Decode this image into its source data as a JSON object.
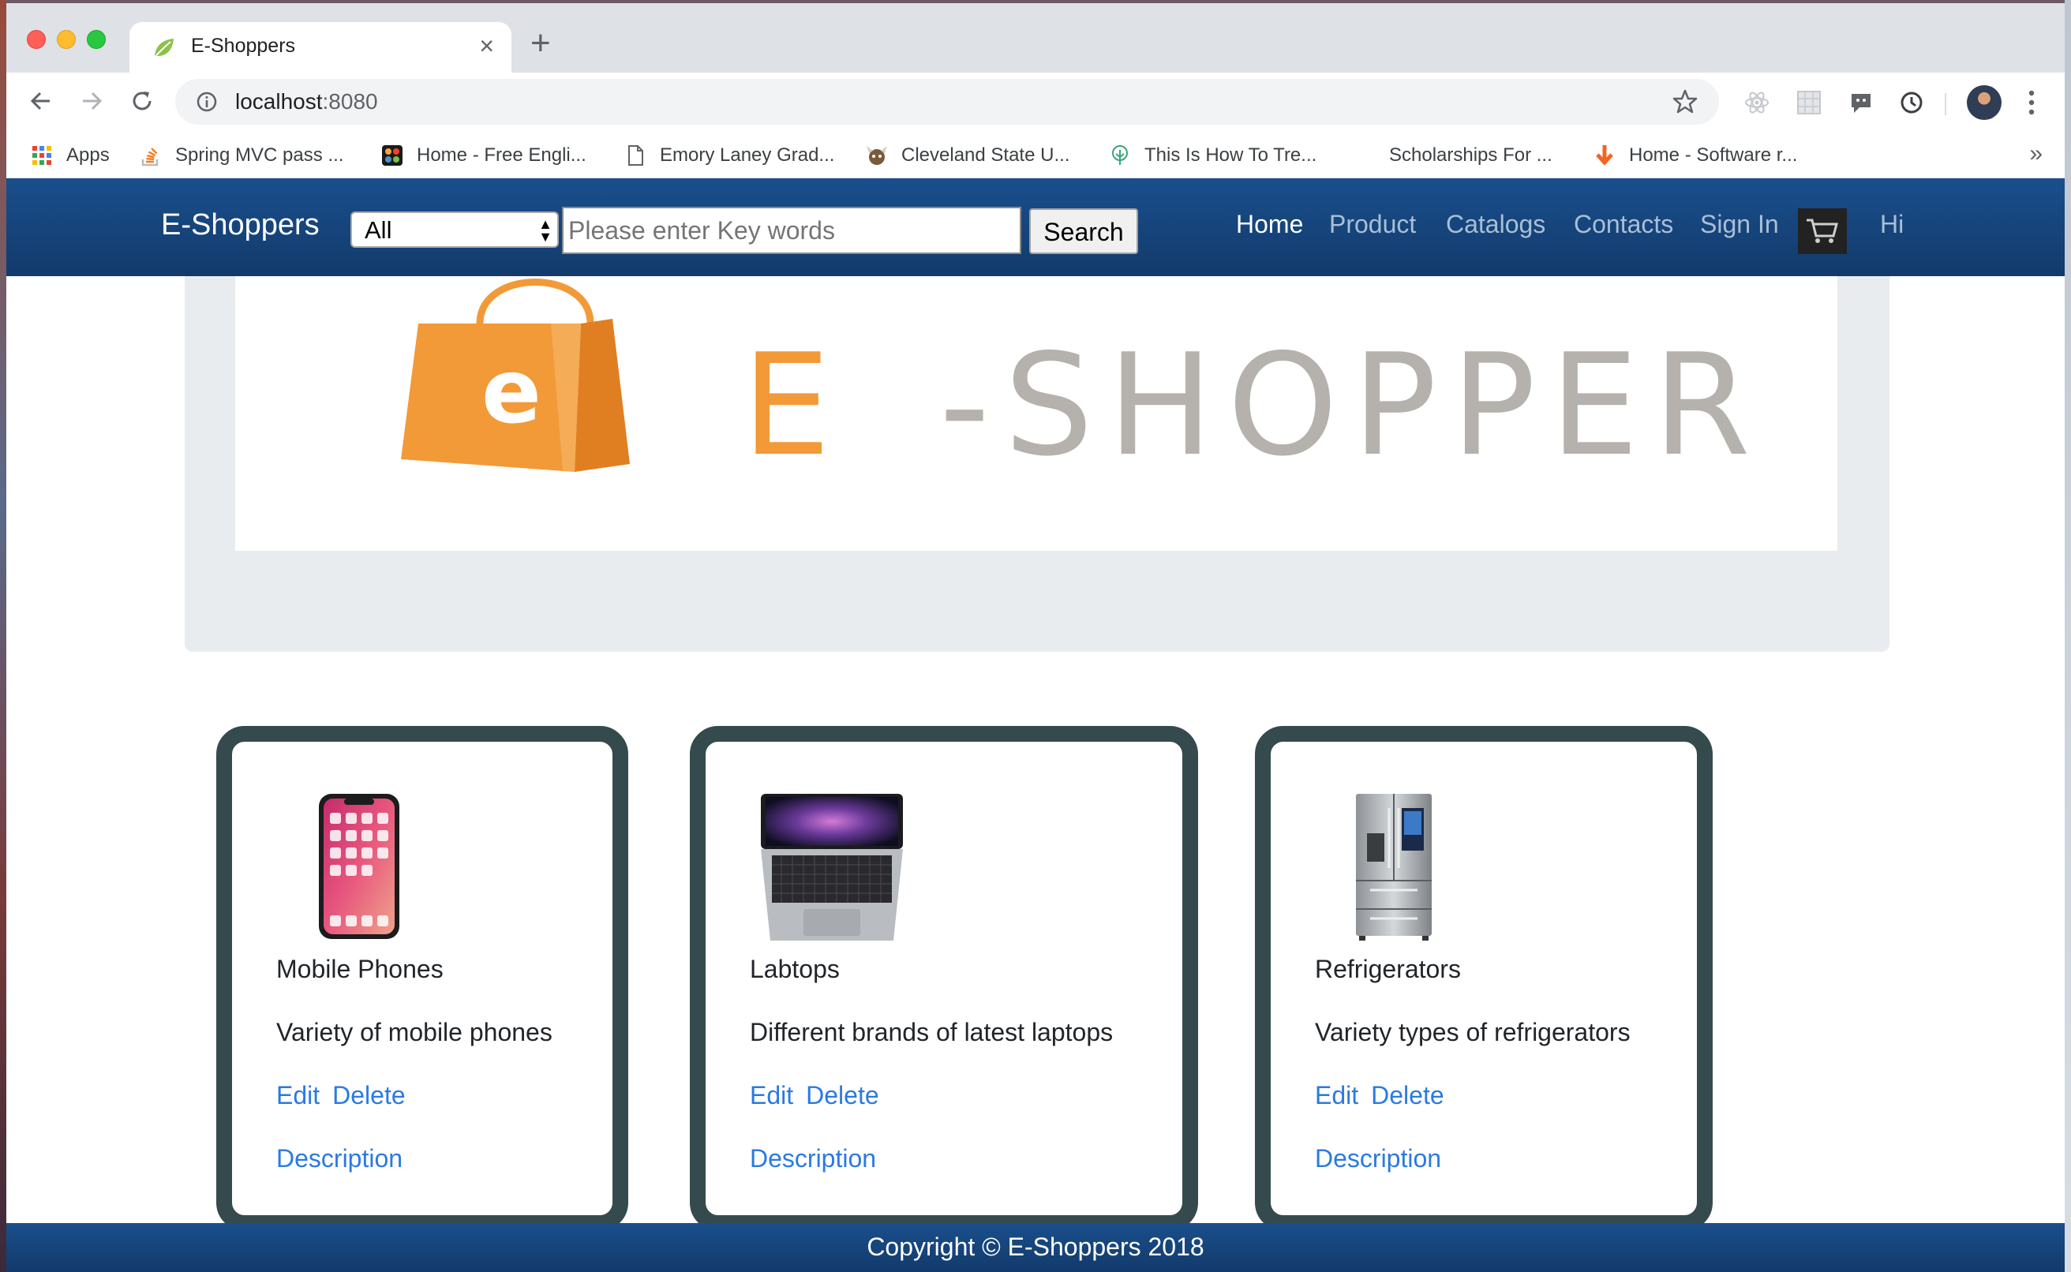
{
  "browser": {
    "tab_title": "E-Shoppers",
    "url_host": "localhost",
    "url_port": ":8080",
    "bookmarks": [
      {
        "label": "Apps",
        "icon": "apps-grid-icon"
      },
      {
        "label": "Spring MVC pass ...",
        "icon": "stackoverflow-icon"
      },
      {
        "label": "Home - Free Engli...",
        "icon": "joomla-icon"
      },
      {
        "label": "Emory Laney Grad...",
        "icon": "document-icon"
      },
      {
        "label": "Cleveland State U...",
        "icon": "viking-icon"
      },
      {
        "label": "This Is How To Tre...",
        "icon": "tree-icon"
      },
      {
        "label": "Scholarships For ...",
        "icon": ""
      },
      {
        "label": "Home - Software r...",
        "icon": "down-arrow-icon"
      }
    ]
  },
  "navbar": {
    "brand": "E-Shoppers",
    "category_selected": "All",
    "search_placeholder": "Please enter Key words",
    "search_label": "Search",
    "links": [
      "Home",
      "Product",
      "Catalogs",
      "Contacts",
      "Sign In"
    ],
    "greeting": "Hi"
  },
  "banner": {
    "logo_letter": "e",
    "title_first": "E",
    "title_rest": "-SHOPPER"
  },
  "categories": [
    {
      "title": "Mobile Phones",
      "description": "Variety of mobile phones",
      "edit": "Edit",
      "delete": "Delete",
      "link": "Description"
    },
    {
      "title": "Labtops",
      "description": "Different brands of latest laptops",
      "edit": "Edit",
      "delete": "Delete",
      "link": "Description"
    },
    {
      "title": "Refrigerators",
      "description": "Variety types of refrigerators",
      "edit": "Edit",
      "delete": "Delete",
      "link": "Description"
    }
  ],
  "footer": {
    "text": "Copyright © E-Shoppers 2018"
  },
  "colors": {
    "navbar": "#1a4f8c",
    "card_border": "#354a4d",
    "link": "#2a7ae2",
    "brand_orange": "#f29a38",
    "brand_gray": "#b5b2ae"
  }
}
